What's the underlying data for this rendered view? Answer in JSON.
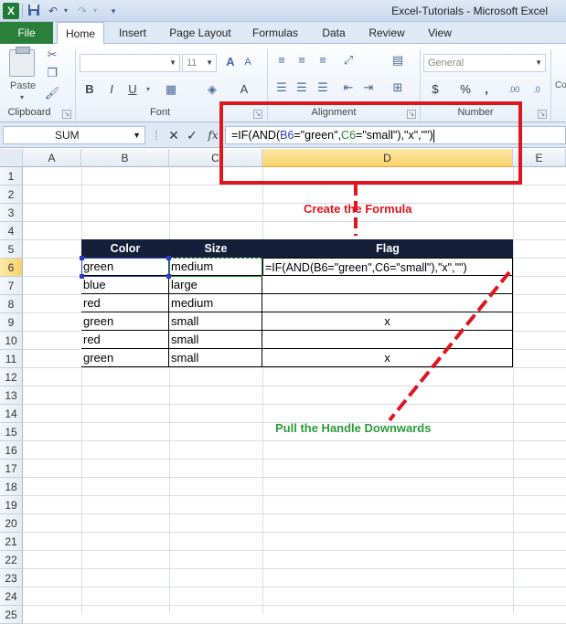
{
  "window": {
    "title": "Excel-Tutorials  -  Microsoft Excel",
    "app_logo": "X"
  },
  "quick_access": {
    "save": "save-icon",
    "undo": "undo-icon",
    "redo": "redo-icon",
    "customize": "customize-icon"
  },
  "ribbon_tabs": [
    "File",
    "Home",
    "Insert",
    "Page Layout",
    "Formulas",
    "Data",
    "Review",
    "View"
  ],
  "ribbon": {
    "clipboard": {
      "paste_label": "Paste",
      "group_label": "Clipboard"
    },
    "font": {
      "size_value": "11",
      "group_label": "Font",
      "bold": "B",
      "italic": "I",
      "underline": "U",
      "grow": "A",
      "shrink": "A"
    },
    "alignment": {
      "group_label": "Alignment"
    },
    "number": {
      "format_value": "General",
      "group_label": "Number",
      "currency": "$",
      "percent": "%",
      "comma": ",",
      "cut_off_label": "Co"
    }
  },
  "formula_bar": {
    "name_box": "SUM",
    "cancel": "✕",
    "enter": "✓",
    "fx": "fx",
    "formula_parts": [
      "=IF(AND(",
      "B6",
      "=\"green\",",
      "C6",
      "=\"small\"),\"x\",\"\")"
    ]
  },
  "columns": [
    "A",
    "B",
    "C",
    "D",
    "E"
  ],
  "rows": [
    "1",
    "2",
    "3",
    "4",
    "5",
    "6",
    "7",
    "8",
    "9",
    "10",
    "11",
    "12",
    "13",
    "14",
    "15",
    "16",
    "17",
    "18",
    "19",
    "20",
    "21",
    "22",
    "23",
    "24",
    "25"
  ],
  "table": {
    "headers": [
      "Color",
      "Size",
      "Flag"
    ],
    "rows": [
      [
        "green",
        "medium",
        "=IF(AND(B6=\"green\",C6=\"small\"),\"x\",\"\")"
      ],
      [
        "blue",
        "large",
        ""
      ],
      [
        "red",
        "medium",
        ""
      ],
      [
        "green",
        "small",
        "x"
      ],
      [
        "red",
        "small",
        ""
      ],
      [
        "green",
        "small",
        "x"
      ]
    ]
  },
  "annotations": {
    "create": "Create the Formula",
    "pull": "Pull the Handle Downwards",
    "red": "#e0161f",
    "green": "#2a9d3a"
  }
}
